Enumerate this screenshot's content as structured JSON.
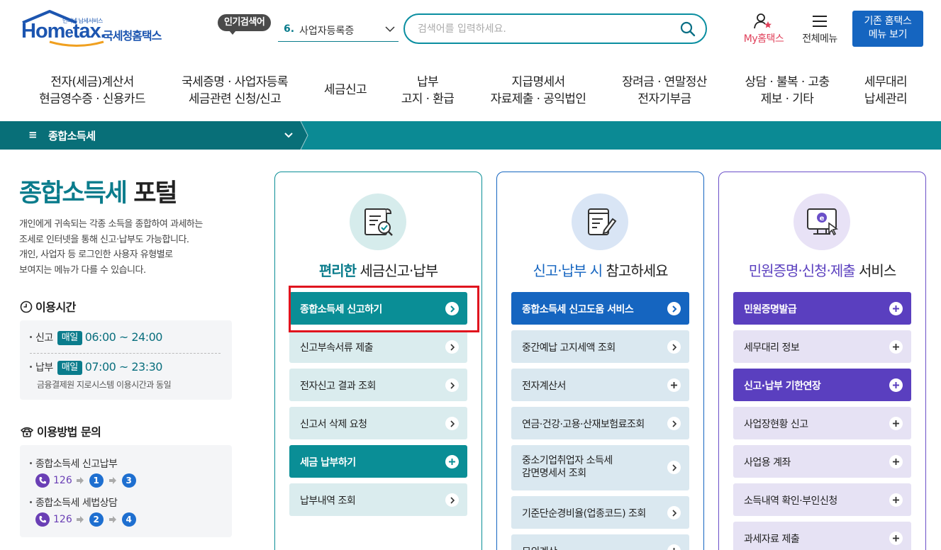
{
  "header": {
    "logo": {
      "tiny": "인터넷 납세서비스",
      "word_a": "Hom",
      "word_e": "e",
      "word_b": "tax.",
      "kr": "국세청홈택스"
    },
    "popular": {
      "badge": "인기검색어",
      "num": "6.",
      "term": "사업자등록증"
    },
    "search": {
      "placeholder": "검색어를 입력하세요."
    },
    "my_hometax": "My홈택스",
    "all_menu": "전체메뉴",
    "old_menu_line1": "기존 홈택스",
    "old_menu_line2": "메뉴 보기"
  },
  "gnb": [
    {
      "l1": "전자(세금)계산서",
      "l2": "현금영수증 · 신용카드"
    },
    {
      "l1": "국세증명 · 사업자등록",
      "l2": "세금관련 신청/신고"
    },
    {
      "l1": "세금신고",
      "l2": ""
    },
    {
      "l1": "납부",
      "l2": "고지 · 환급"
    },
    {
      "l1": "지급명세서",
      "l2": "자료제출 · 공익법인"
    },
    {
      "l1": "장려금 · 연말정산",
      "l2": "전자기부금"
    },
    {
      "l1": "상담 · 불복 · 고충",
      "l2": "제보 · 기타"
    },
    {
      "l1": "세무대리",
      "l2": "납세관리"
    }
  ],
  "subbar": {
    "menu_icon": "≡",
    "title": "종합소득세"
  },
  "left": {
    "title_a": "종합소득세",
    "title_b": "포털",
    "desc": [
      "개인에게 귀속되는 각종 소득을 종합하여 과세하는",
      "조세로 인터넷을 통해 신고·납부도 가능합니다.",
      "개인, 사업자 등 로그인한 사용자 유형별로",
      "보여지는 메뉴가 다를 수 있습니다."
    ],
    "hours": {
      "head": "이용시간",
      "report_label": "신고",
      "report_badge": "매일",
      "report_time": "06:00 ~ 24:00",
      "pay_label": "납부",
      "pay_badge": "매일",
      "pay_time": "07:00 ~ 23:30",
      "note": "금융결제원 지로시스템 이용시간과 동일"
    },
    "inquiry": {
      "head": "이용방법 문의",
      "q1": "종합소득세 신고납부",
      "q1_phone": "126",
      "q1_a": "1",
      "q1_b": "3",
      "q2": "종합소득세 세법상담",
      "q2_phone": "126",
      "q2_a": "2",
      "q2_b": "4"
    }
  },
  "cards": [
    {
      "title_hl": "편리한",
      "title_rest": " 세금신고·납부",
      "items": [
        "종합소득세 신고하기",
        "신고부속서류 제출",
        "전자신고 결과 조회",
        "신고서 삭제 요청",
        "세금 납부하기",
        "납부내역 조회"
      ]
    },
    {
      "title_hl": "신고·납부 시",
      "title_rest": " 참고하세요",
      "items": [
        "종합소득세 신고도움 서비스",
        "중간예납 고지세액 조회",
        "전자계산서",
        "연금·건강·고용·산재보험료조회",
        "중소기업취업자 소득세",
        "감면명세서 조회",
        "기준단순경비율(업종코드) 조회",
        "모의계산"
      ]
    },
    {
      "title_hl": "민원증명·신청·제출",
      "title_rest": " 서비스",
      "items": [
        "민원증명발급",
        "세무대리 정보",
        "신고·납부 기한연장",
        "사업장현황 신고",
        "사업용 계좌",
        "소득내역 확인·부인신청",
        "과세자료 제출"
      ]
    }
  ],
  "colors": {
    "teal": "#0a8e96",
    "blue": "#1565c0",
    "purple": "#5a3fbf",
    "highlight": "#e0141e"
  }
}
